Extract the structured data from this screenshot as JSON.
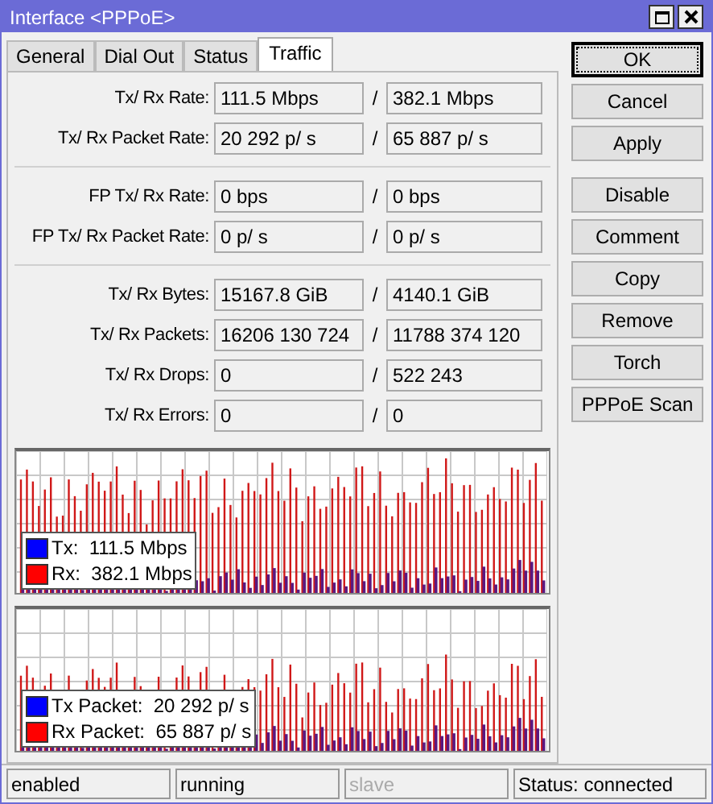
{
  "window": {
    "title": "Interface <PPPoE>"
  },
  "tabs": [
    {
      "label": "General",
      "selected": false
    },
    {
      "label": "Dial Out",
      "selected": false
    },
    {
      "label": "Status",
      "selected": false
    },
    {
      "label": "Traffic",
      "selected": true
    }
  ],
  "sections": [
    {
      "rows": [
        {
          "label": "Tx/ Rx Rate:",
          "tx": "111.5 Mbps",
          "separator": "/",
          "rx": "382.1 Mbps"
        },
        {
          "label": "Tx/ Rx Packet Rate:",
          "tx": "20 292 p/ s",
          "separator": "/",
          "rx": "65 887 p/ s"
        }
      ]
    },
    {
      "rows": [
        {
          "label": "FP Tx/ Rx Rate:",
          "tx": "0 bps",
          "separator": "/",
          "rx": "0 bps"
        },
        {
          "label": "FP Tx/ Rx Packet Rate:",
          "tx": "0 p/ s",
          "separator": "/",
          "rx": "0 p/ s"
        }
      ]
    },
    {
      "rows": [
        {
          "label": "Tx/ Rx Bytes:",
          "tx": "15167.8 GiB",
          "separator": "/",
          "rx": "4140.1 GiB"
        },
        {
          "label": "Tx/ Rx Packets:",
          "tx": "16206 130 724",
          "separator": "/",
          "rx": "11788 374 120"
        },
        {
          "label": "Tx/ Rx Drops:",
          "tx": "0",
          "separator": "/",
          "rx": "522 243"
        },
        {
          "label": "Tx/ Rx Errors:",
          "tx": "0",
          "separator": "/",
          "rx": "0"
        }
      ]
    }
  ],
  "graphs": [
    {
      "legend": [
        {
          "label": "Tx:  111.5 Mbps",
          "color": "#0000ff"
        },
        {
          "label": "Rx:  382.1 Mbps",
          "color": "#ff0000"
        }
      ]
    },
    {
      "legend": [
        {
          "label": "Tx Packet:  20 292 p/ s",
          "color": "#0000ff"
        },
        {
          "label": "Rx Packet:  65 887 p/ s",
          "color": "#ff0000"
        }
      ]
    }
  ],
  "buttons": [
    {
      "label": "OK",
      "focused": true
    },
    {
      "label": "Cancel",
      "focused": false
    },
    {
      "label": "Apply",
      "focused": false
    },
    {
      "label": "Disable",
      "focused": false
    },
    {
      "label": "Comment",
      "focused": false
    },
    {
      "label": "Copy",
      "focused": false
    },
    {
      "label": "Remove",
      "focused": false
    },
    {
      "label": "Torch",
      "focused": false
    },
    {
      "label": "PPPoE Scan",
      "focused": false
    }
  ],
  "status_bar": [
    {
      "text": "enabled",
      "disabled": false
    },
    {
      "text": "running",
      "disabled": false
    },
    {
      "text": "slave",
      "disabled": true
    },
    {
      "text": "Status: connected",
      "disabled": false
    }
  ]
}
